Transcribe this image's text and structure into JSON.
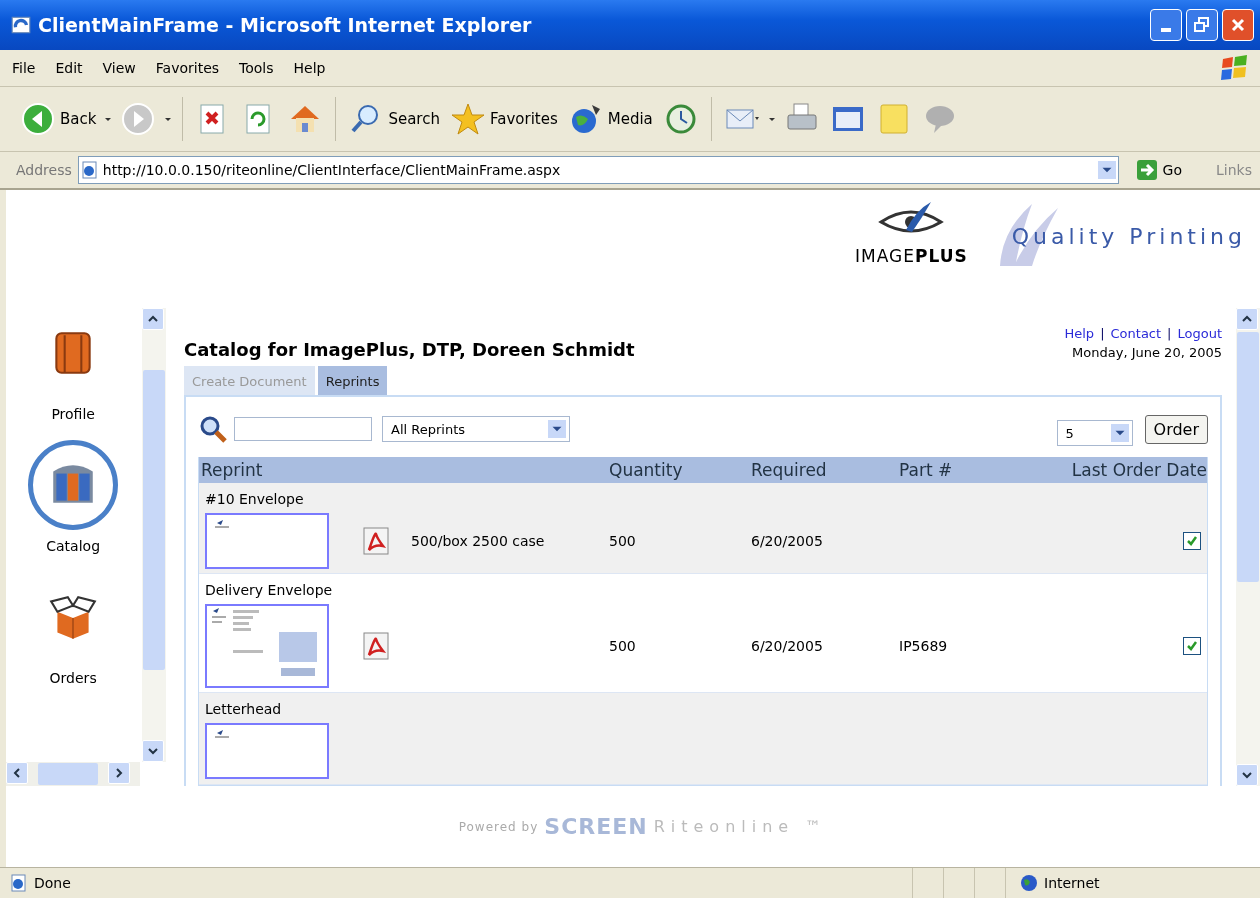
{
  "window": {
    "title": "ClientMainFrame - Microsoft Internet Explorer"
  },
  "menu": [
    "File",
    "Edit",
    "View",
    "Favorites",
    "Tools",
    "Help"
  ],
  "toolbar": [
    {
      "kind": "back",
      "label": "Back"
    },
    {
      "kind": "forward"
    },
    {
      "kind": "stop"
    },
    {
      "kind": "refresh"
    },
    {
      "kind": "home"
    },
    {
      "kind": "search",
      "label": "Search"
    },
    {
      "kind": "favorites",
      "label": "Favorites"
    },
    {
      "kind": "media",
      "label": "Media"
    },
    {
      "kind": "history"
    },
    {
      "kind": "mail"
    },
    {
      "kind": "print"
    },
    {
      "kind": "edit"
    },
    {
      "kind": "note"
    },
    {
      "kind": "messenger"
    }
  ],
  "address": {
    "label": "Address",
    "url": "http://10.0.0.150/riteonline/ClientInterface/ClientMainFrame.aspx",
    "go": "Go",
    "links": "Links"
  },
  "brand": {
    "logo": "IMAGE**PLUS**",
    "tagline": "Quality Printing"
  },
  "sidebar": {
    "items": [
      {
        "kind": "profile",
        "label": "Profile",
        "selected": false
      },
      {
        "kind": "catalog",
        "label": "Catalog",
        "selected": true
      },
      {
        "kind": "orders",
        "label": "Orders",
        "selected": false
      }
    ]
  },
  "page": {
    "title": "Catalog for ImagePlus, DTP, Doreen Schmidt",
    "links": [
      {
        "kind": "link",
        "text": "Help"
      },
      {
        "kind": "separator",
        "text": "|"
      },
      {
        "kind": "link",
        "text": "Contact"
      },
      {
        "kind": "separator",
        "text": "|"
      },
      {
        "kind": "link",
        "text": "Logout"
      }
    ],
    "date": "Monday, June 20, 2005"
  },
  "tabs": [
    {
      "label": "Create Document",
      "selected": false
    },
    {
      "label": "Reprints",
      "selected": true
    }
  ],
  "filter": {
    "category": "All Reprints",
    "count": "5",
    "order_button": "Order"
  },
  "table": {
    "columns": [
      "Reprint",
      "Quantity",
      "Required",
      "Part #",
      "Last Order Date"
    ],
    "rows": [
      {
        "name": "#10 Envelope",
        "kind": "blank",
        "pdf": true,
        "description": "500/box 2500 case",
        "quantity": "500",
        "required": "6/20/2005",
        "checked": true
      },
      {
        "name": "Delivery Envelope",
        "kind": "form",
        "pdf": true,
        "quantity": "500",
        "required": "6/20/2005",
        "part": "IP5689",
        "checked": true
      },
      {
        "name": "Letterhead",
        "kind": "blank",
        "pdf": false
      }
    ]
  },
  "footer": {
    "powered": "Powered by",
    "brand": "SCREEN",
    "product": "Riteonline ™"
  },
  "status_bar": {
    "text": "Done",
    "zone": "Internet"
  }
}
